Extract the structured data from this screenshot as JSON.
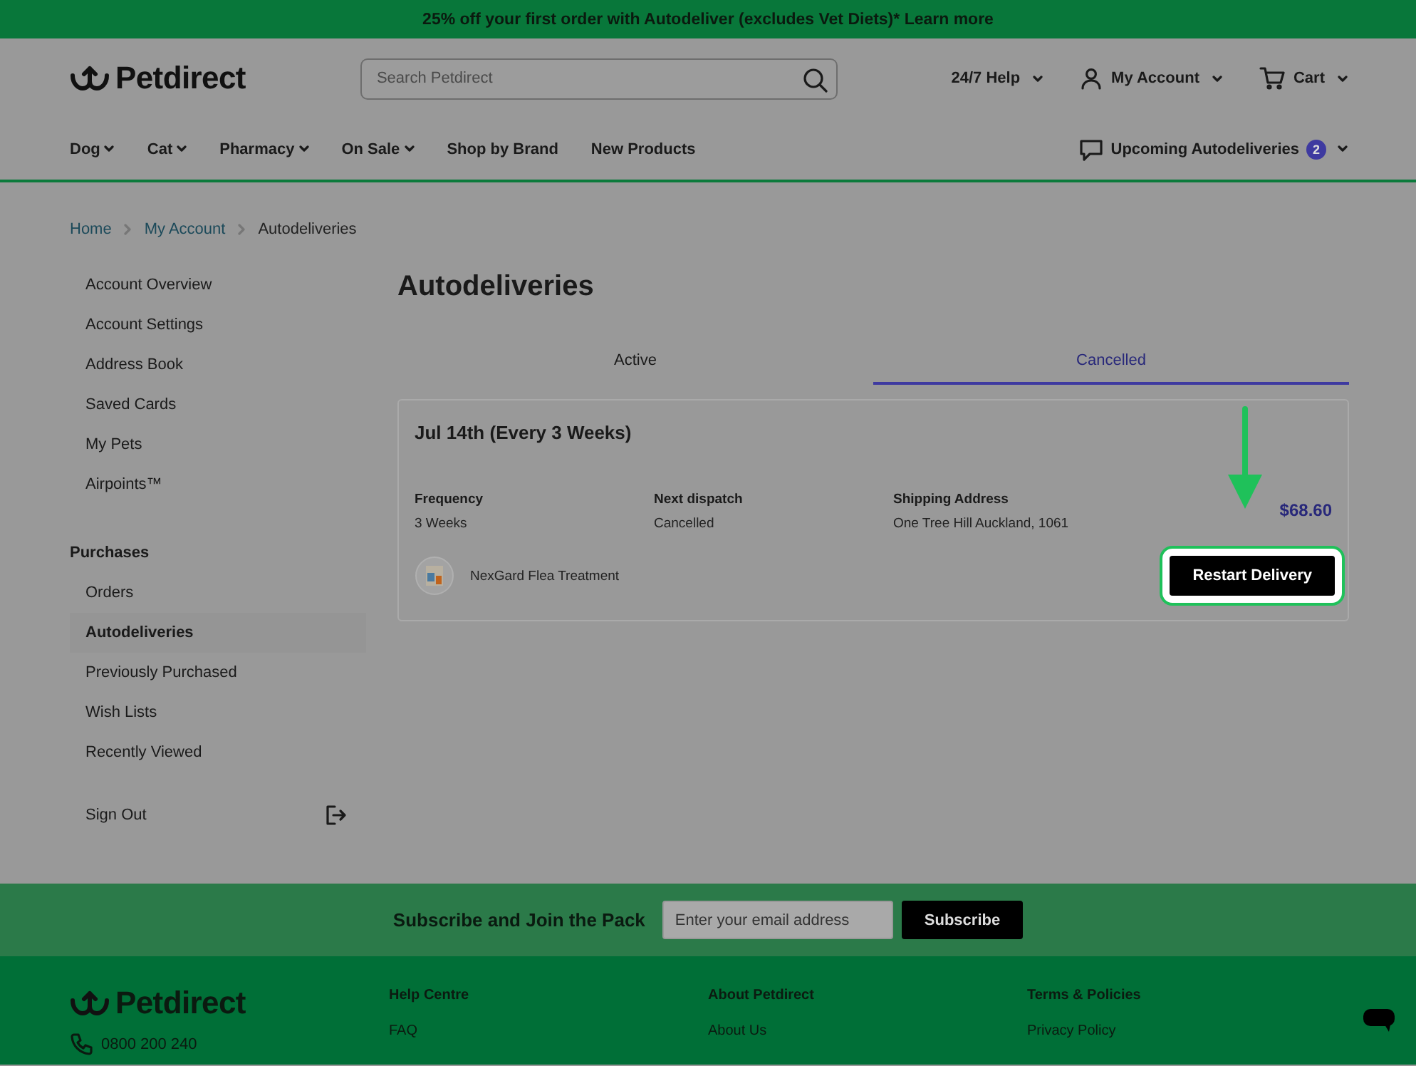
{
  "banner": {
    "text": "25% off your first order with Autodeliver (excludes Vet Diets)*",
    "link": "Learn more"
  },
  "header": {
    "logo": "Petdirect",
    "search": {
      "placeholder": "Search Petdirect"
    },
    "utilities": [
      {
        "kind": "help",
        "label": "24/7 Help"
      },
      {
        "kind": "account",
        "label": "My Account"
      },
      {
        "kind": "cart",
        "label": "Cart"
      }
    ]
  },
  "nav": {
    "items": [
      {
        "label": "Dog",
        "dropdown": true
      },
      {
        "label": "Cat",
        "dropdown": true
      },
      {
        "label": "Pharmacy",
        "dropdown": true
      },
      {
        "label": "On Sale",
        "dropdown": true
      },
      {
        "label": "Shop by Brand",
        "dropdown": false
      },
      {
        "label": "New Products",
        "dropdown": false
      }
    ],
    "autodeliveries": {
      "label": "Upcoming Autodeliveries",
      "count": "2"
    }
  },
  "breadcrumb": [
    "Home",
    "My Account",
    "Autodeliveries"
  ],
  "sidebar": {
    "groups": [
      {
        "items": [
          {
            "label": "Account Overview",
            "selected": false
          },
          {
            "label": "Account Settings",
            "selected": false
          },
          {
            "label": "Address Book",
            "selected": false
          },
          {
            "label": "Saved Cards",
            "selected": false
          },
          {
            "label": "My Pets",
            "selected": false
          },
          {
            "label": "Airpoints™",
            "selected": false
          }
        ]
      },
      {
        "heading": "Purchases",
        "items": [
          {
            "label": "Orders",
            "selected": false
          },
          {
            "label": "Autodeliveries",
            "selected": true
          },
          {
            "label": "Previously Purchased",
            "selected": false
          },
          {
            "label": "Wish Lists",
            "selected": false
          },
          {
            "label": "Recently Viewed",
            "selected": false
          }
        ]
      }
    ],
    "sign_out": "Sign Out"
  },
  "page_title": "Autodeliveries",
  "tabs": [
    {
      "label": "Active",
      "selected": false
    },
    {
      "label": "Cancelled",
      "selected": true
    }
  ],
  "deliveries": [
    {
      "title": "Jul 14th (Every 3 Weeks)",
      "fields": [
        {
          "label": "Frequency",
          "value": "3 Weeks"
        },
        {
          "label": "Next dispatch",
          "value": "Cancelled"
        },
        {
          "label": "Shipping Address",
          "value": "One Tree Hill Auckland, 1061"
        }
      ],
      "price": "$68.60",
      "product": "NexGard Flea Treatment",
      "button": "Restart Delivery",
      "highlighted": true
    }
  ],
  "subscribe": {
    "title": "Subscribe and Join the Pack",
    "placeholder": "Enter your email address",
    "button": "Subscribe"
  },
  "footer": {
    "logo": "Petdirect",
    "phone": "0800 200 240",
    "columns": [
      {
        "heading": "Help Centre",
        "links": [
          "FAQ"
        ]
      },
      {
        "heading": "About Petdirect",
        "links": [
          "About Us"
        ]
      },
      {
        "heading": "Terms & Policies",
        "links": [
          "Privacy Policy"
        ]
      }
    ]
  }
}
